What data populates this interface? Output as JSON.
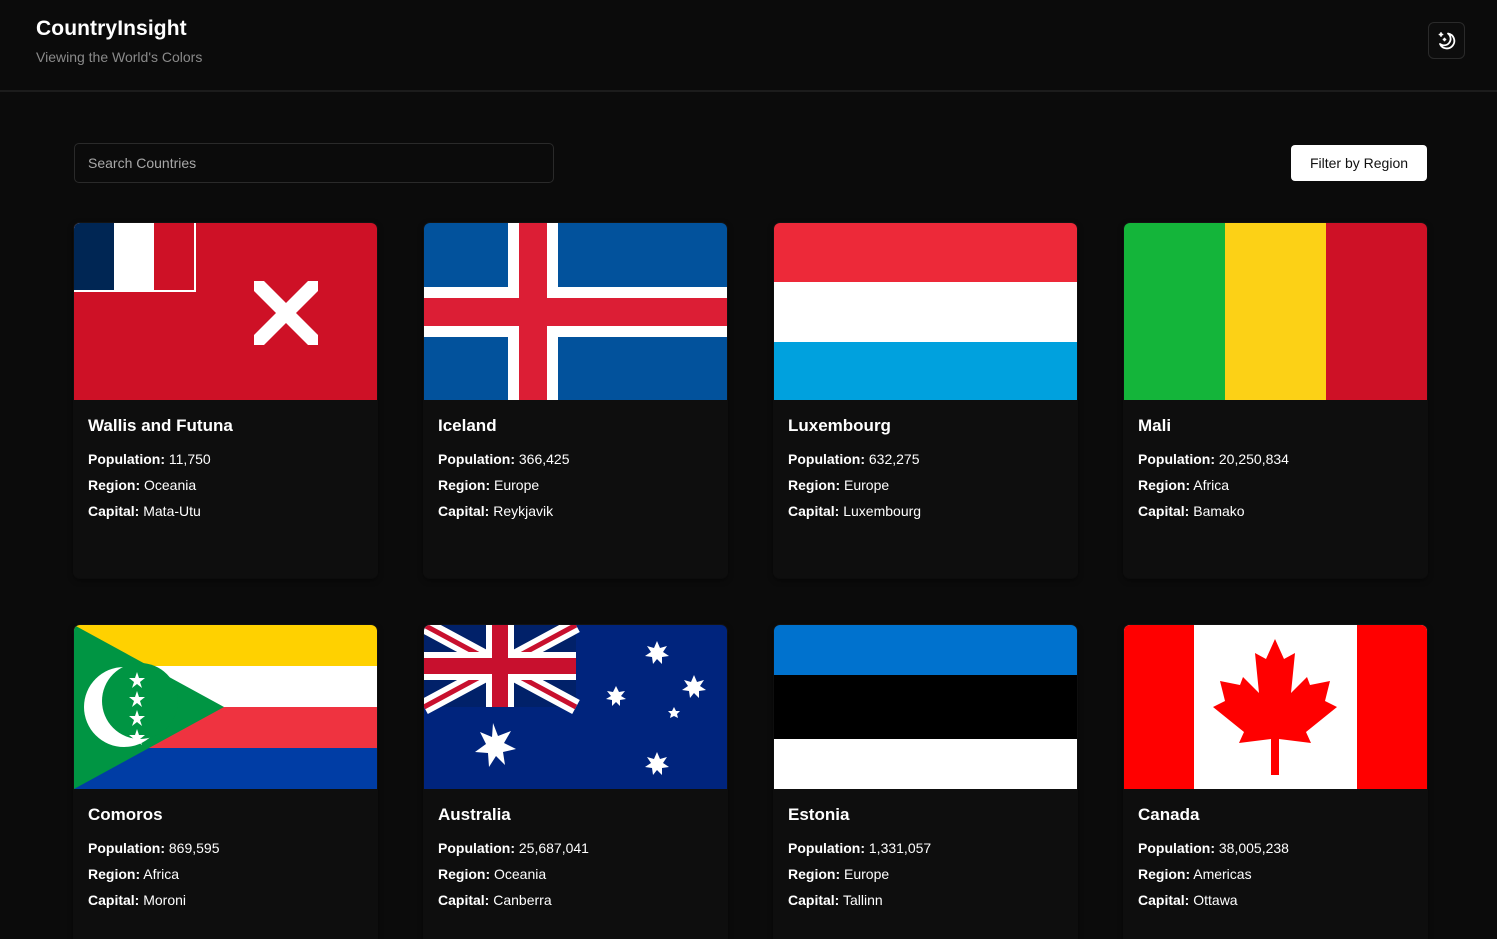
{
  "header": {
    "title": "CountryInsight",
    "subtitle": "Viewing the World's Colors",
    "theme_icon": "moon-stars-icon"
  },
  "search": {
    "placeholder": "Search Countries",
    "value": ""
  },
  "filter": {
    "label": "Filter by Region"
  },
  "labels": {
    "population": "Population:",
    "region": "Region:",
    "capital": "Capital:"
  },
  "countries": [
    {
      "name": "Wallis and Futuna",
      "population": "11,750",
      "region": "Oceania",
      "capital": "Mata-Utu",
      "flag": "wallis-futuna-flag"
    },
    {
      "name": "Iceland",
      "population": "366,425",
      "region": "Europe",
      "capital": "Reykjavik",
      "flag": "iceland-flag"
    },
    {
      "name": "Luxembourg",
      "population": "632,275",
      "region": "Europe",
      "capital": "Luxembourg",
      "flag": "luxembourg-flag"
    },
    {
      "name": "Mali",
      "population": "20,250,834",
      "region": "Africa",
      "capital": "Bamako",
      "flag": "mali-flag"
    },
    {
      "name": "Comoros",
      "population": "869,595",
      "region": "Africa",
      "capital": "Moroni",
      "flag": "comoros-flag"
    },
    {
      "name": "Australia",
      "population": "25,687,041",
      "region": "Oceania",
      "capital": "Canberra",
      "flag": "australia-flag"
    },
    {
      "name": "Estonia",
      "population": "1,331,057",
      "region": "Europe",
      "capital": "Tallinn",
      "flag": "estonia-flag"
    },
    {
      "name": "Canada",
      "population": "38,005,238",
      "region": "Americas",
      "capital": "Ottawa",
      "flag": "canada-flag"
    }
  ],
  "colors": {
    "background": "#0b0b0b",
    "card": "#0e0e0e",
    "muted_text": "#8a8a8a"
  }
}
